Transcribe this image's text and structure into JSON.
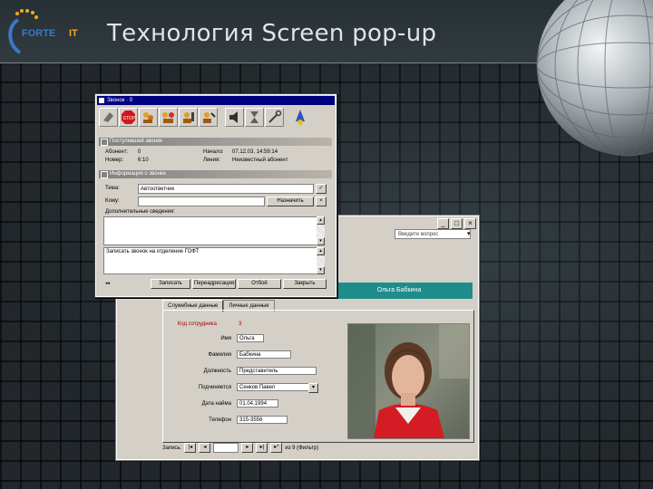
{
  "slide": {
    "title": "Технология Screen pop-up",
    "logo_text": "FORTE IT"
  },
  "popup": {
    "window_title": "Звонок · 0",
    "section_incoming": "Поступивший звонок",
    "subscriber_label": "Абонент:",
    "subscriber_value": "0",
    "number_label": "Номер:",
    "number_value": "6:10",
    "time_label": "Начало:",
    "time_value": "07.12.03, 14:59:14",
    "line_label": "Линия:",
    "line_value": "Неизвестный абонент",
    "section_message": "Информация о звонке",
    "topic_label": "Тема:",
    "topic_value": "Автоответчик",
    "to_label": "Кому:",
    "to_value": "",
    "assign_button": "Назначить",
    "comment_label": "Дополнительные сведения:",
    "comment_text": "",
    "note_text": "Записать звонок на отделение ГОФТ",
    "buttons": [
      "Записать",
      "Переадресация",
      "Отбой",
      "Закрыть"
    ]
  },
  "form": {
    "help_placeholder": "Введите вопрос",
    "banner_name": "Ольга Бабкина",
    "tabs": [
      "Служебные данные",
      "Личные данные"
    ],
    "code_label": "Код сотрудника",
    "code_value": "3",
    "fields": [
      {
        "label": "Имя",
        "value": "Ольга"
      },
      {
        "label": "Фамилия",
        "value": "Бабкина"
      },
      {
        "label": "Должность",
        "value": "Представитель"
      },
      {
        "label": "Подчиняется",
        "value": "Сенков Павел"
      },
      {
        "label": "Дата найма",
        "value": "01.04.1994"
      },
      {
        "label": "Телефон",
        "value": "315-3556"
      }
    ],
    "nav_label": "Запись:",
    "nav_of": "из 9 (Фильтр)"
  },
  "colors": {
    "banner": "#1f8c8c",
    "titlebar": "#000080",
    "title_text": "#e2e4e6"
  }
}
